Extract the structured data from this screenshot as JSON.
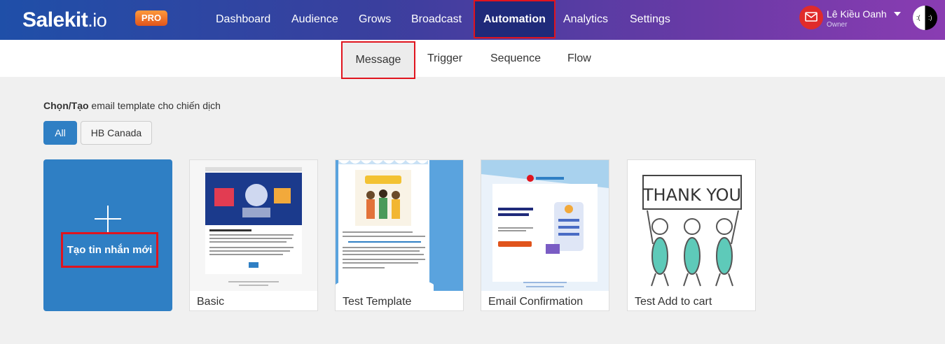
{
  "brand": {
    "name": "Salekit",
    "suffix": ".io",
    "badge": "PRO"
  },
  "nav": {
    "items": [
      {
        "label": "Dashboard"
      },
      {
        "label": "Audience"
      },
      {
        "label": "Grows"
      },
      {
        "label": "Broadcast"
      },
      {
        "label": "Automation",
        "active": true
      },
      {
        "label": "Analytics"
      },
      {
        "label": "Settings"
      }
    ]
  },
  "user": {
    "name": "Lê Kiều Oanh",
    "role": "Owner",
    "avatar_left": ":(",
    "avatar_right": ":)"
  },
  "subtabs": [
    {
      "label": "Message",
      "active": true
    },
    {
      "label": "Trigger"
    },
    {
      "label": "Sequence"
    },
    {
      "label": "Flow"
    }
  ],
  "section": {
    "title_bold": "Chọn/Tạo",
    "title_rest": " email template cho chiến dịch"
  },
  "filters": [
    {
      "label": "All",
      "active": true
    },
    {
      "label": "HB Canada"
    }
  ],
  "create_card": {
    "label": "Tạo tin nhắn mới"
  },
  "templates": [
    {
      "caption": "Basic",
      "thumb_text": "Email tiếp quà"
    },
    {
      "caption": "Test Template",
      "thumb_text": "WELCOME"
    },
    {
      "caption": "Email Confirmation",
      "thumb_brand": "ULTRAMAILER",
      "thumb_heading": "CONFIRM YOUR REGISTRATION",
      "thumb_button": "CONFIRM YOUR EMAIL"
    },
    {
      "caption": "Test Add to cart",
      "thumb_text": "THANK YOU"
    }
  ],
  "colors": {
    "accent": "#2f7fc4",
    "highlight": "#e0141e",
    "nav_start": "#1f4fa8",
    "nav_end": "#8a3cb2"
  }
}
